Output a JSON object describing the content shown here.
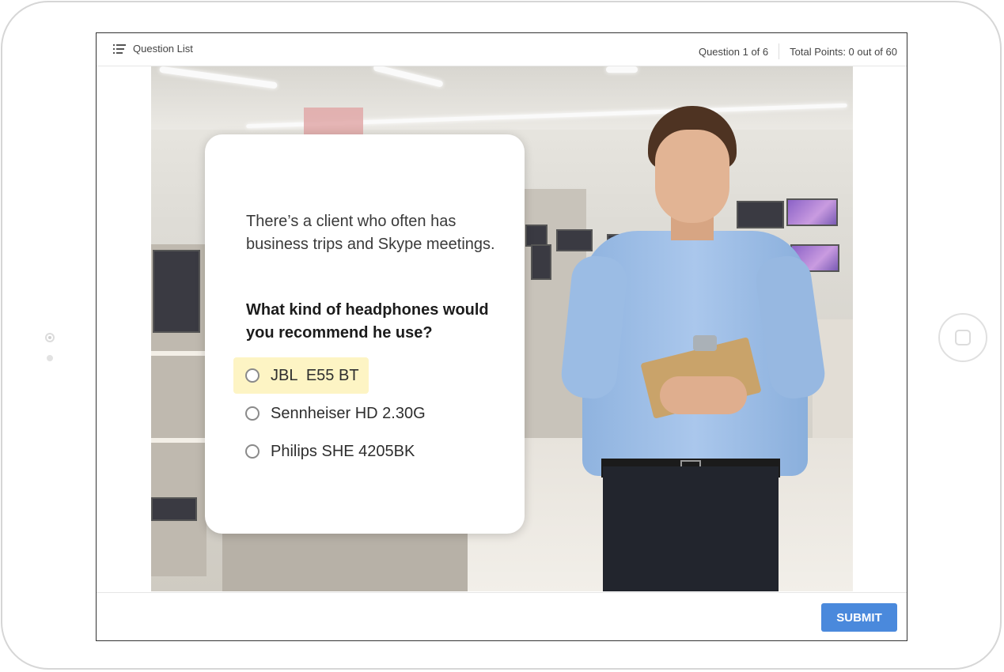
{
  "topbar": {
    "question_list_label": "Question List",
    "question_counter": "Question 1 of 6",
    "total_points": "Total Points: 0 out of 60"
  },
  "question": {
    "stem": "There’s a client who often has business trips and Skype meetings.",
    "prompt": "What kind of headphones would you recommend he use?",
    "options": [
      {
        "label": "JBL  E55 BT",
        "highlighted": true
      },
      {
        "label": "Sennheiser HD 2.30G",
        "highlighted": false
      },
      {
        "label": "Philips SHE 4205BK",
        "highlighted": false
      }
    ]
  },
  "footer": {
    "submit_label": "SUBMIT"
  },
  "colors": {
    "accent": "#4a89dc",
    "highlight": "#fdf4c4"
  },
  "icons": [
    "list-icon",
    "radio-icon"
  ]
}
